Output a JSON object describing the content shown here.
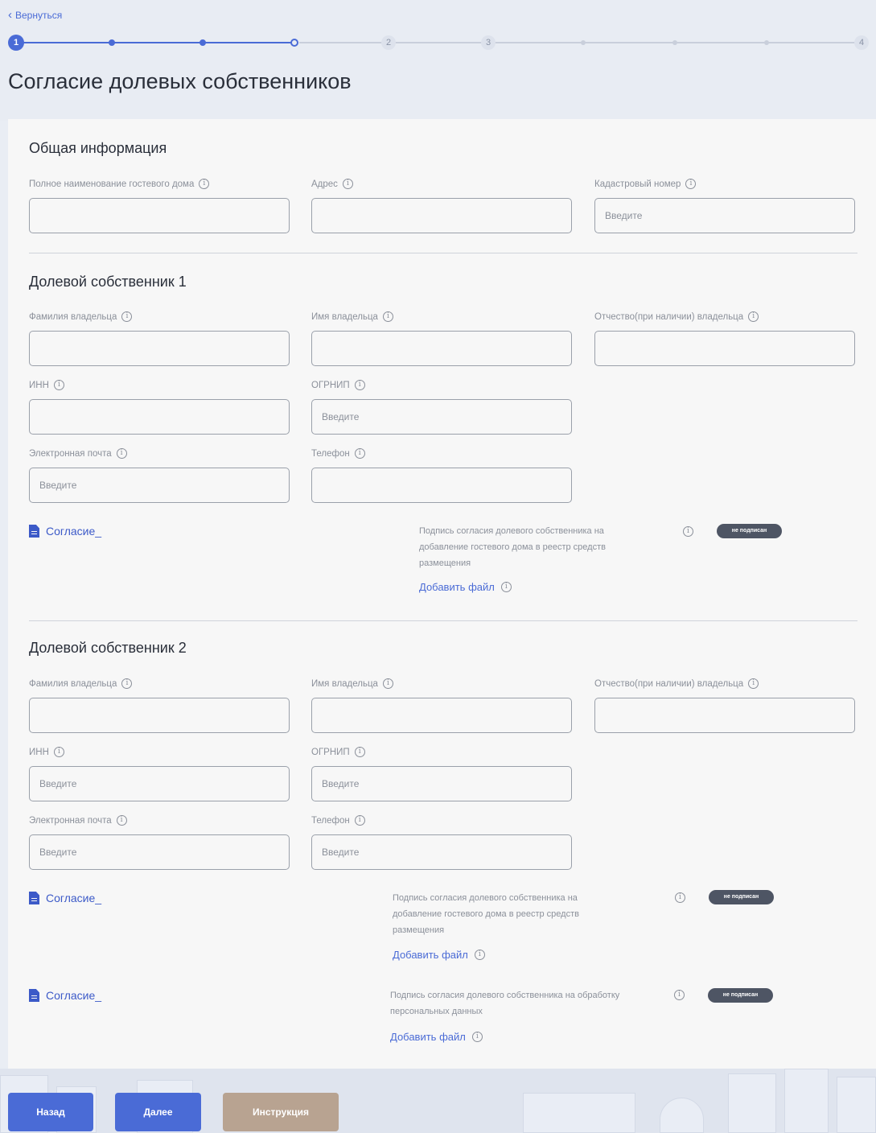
{
  "nav": {
    "back_label": "Вернуться"
  },
  "stepper": {
    "current": "1",
    "steps": [
      "2",
      "3",
      "4"
    ]
  },
  "page": {
    "title": "Согласие долевых собственников"
  },
  "general": {
    "title": "Общая информация",
    "guest_house_name_label": "Полное наименование гостевого дома",
    "address_label": "Адрес",
    "cadastral_label": "Кадастровый номер",
    "cadastral_placeholder": "Введите"
  },
  "owner1": {
    "title": "Долевой собственник 1",
    "lastname_label": "Фамилия владельца",
    "firstname_label": "Имя владельца",
    "patronymic_label": "Отчество(при наличии) владельца",
    "inn_label": "ИНН",
    "ogrnip_label": "ОГРНИП",
    "ogrnip_placeholder": "Введите",
    "email_label": "Электронная почта",
    "email_placeholder": "Введите",
    "phone_label": "Телефон",
    "doc_link": "Согласие_",
    "signature_text": "Подпись согласия долевого собственника на добавление гостевого дома в реестр средств размещения",
    "badge": "не подписан",
    "add_file": "Добавить файл"
  },
  "owner2": {
    "title": "Долевой собственник 2",
    "lastname_label": "Фамилия владельца",
    "firstname_label": "Имя владельца",
    "patronymic_label": "Отчество(при наличии) владельца",
    "inn_label": "ИНН",
    "inn_placeholder": "Введите",
    "ogrnip_label": "ОГРНИП",
    "ogrnip_placeholder": "Введите",
    "email_label": "Электронная почта",
    "email_placeholder": "Введите",
    "phone_label": "Телефон",
    "phone_placeholder": "Введите",
    "doc1_link": "Согласие_",
    "signature1_text": "Подпись согласия долевого собственника на добавление гостевого дома в реестр средств размещения",
    "badge1": "не подписан",
    "add_file1": "Добавить файл",
    "doc2_link": "Согласие_",
    "signature2_text": "Подпись согласия долевого собственника на обработку персональных данных",
    "badge2": "не подписан",
    "add_file2": "Добавить файл"
  },
  "footer": {
    "back_button": "Назад",
    "next_button": "Далее",
    "instruction_button": "Инструкция"
  },
  "colors": {
    "accent": "#4a6bd6",
    "badge": "#4e5564",
    "instruction": "#b8a391"
  }
}
